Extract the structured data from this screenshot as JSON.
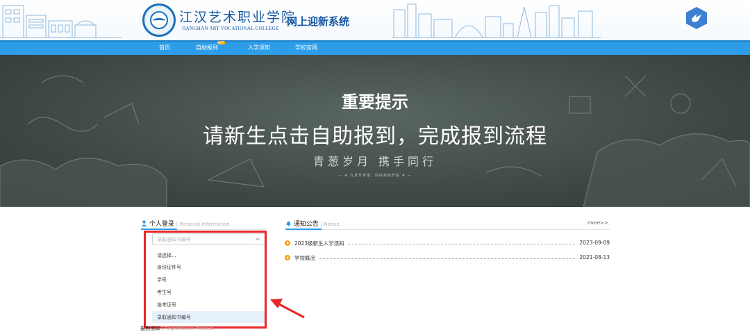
{
  "header": {
    "school_name_cn": "江汉艺术职业学院",
    "school_name_en": "JIANGHAN ART VOCATIONAL COLLEGE",
    "system_title": "网上迎新系统",
    "logo_icon": "school-seal-icon",
    "badge_icon": "dove-badge-icon"
  },
  "nav": {
    "items": [
      {
        "label": "首页"
      },
      {
        "label": "自助报到",
        "badge": "HOT"
      },
      {
        "label": "入学须知"
      },
      {
        "label": "学校官网"
      }
    ]
  },
  "banner": {
    "heading": "重要提示",
    "main_text": "请新生点击自助报到，完成报到流程",
    "slogan": "青葱岁月 携手同行",
    "small_text": "— ★ 九月开学季，你好新的开始 ★ —",
    "slide_count": 3,
    "active_slide": 1
  },
  "login_panel": {
    "title": "个人登录",
    "subtitle": "Personal Information",
    "select_value": "录取通知书编号",
    "options": [
      {
        "label": "请选择..."
      },
      {
        "label": "身份证件号"
      },
      {
        "label": "学号"
      },
      {
        "label": "考生号"
      },
      {
        "label": "准考证号"
      },
      {
        "label": "录取通知书编号",
        "selected": true
      }
    ]
  },
  "notice_panel": {
    "title": "通知公告",
    "subtitle": "Notice",
    "more_label": "more>>",
    "items": [
      {
        "title": "2023级新生入学须知",
        "date": "2023-09-09"
      },
      {
        "title": "学校概况",
        "date": "2021-08-13"
      }
    ]
  },
  "next_panel": {
    "title": "报到须知",
    "subtitle": "Registration Process"
  },
  "colors": {
    "nav_blue": "#2e9de8",
    "brand_blue": "#1557a0",
    "highlight_red": "#e8262a",
    "notice_orange": "#f6a21a"
  }
}
